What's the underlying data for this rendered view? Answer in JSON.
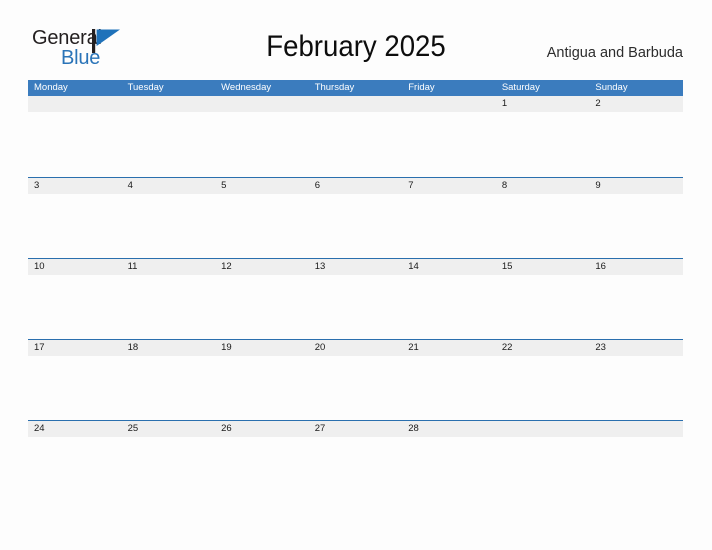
{
  "brand": {
    "name_part_1": "General",
    "name_part_2": "Blue",
    "mark": "flag-triangle-icon",
    "color_dark": "#231f20",
    "color_blue": "#2a74b8"
  },
  "header": {
    "title": "February 2025",
    "locale": "Antigua and Barbuda"
  },
  "colors": {
    "header_blue": "#3b7cbe",
    "rule_blue": "#2a6fae",
    "date_band_gray": "#efefef",
    "page_background": "#fdfdfd"
  },
  "calendar": {
    "month": "February",
    "year": "2025",
    "weekday_headers": [
      "Monday",
      "Tuesday",
      "Wednesday",
      "Thursday",
      "Friday",
      "Saturday",
      "Sunday"
    ],
    "weeks": [
      {
        "days": [
          "",
          "",
          "",
          "",
          "",
          "1",
          "2"
        ]
      },
      {
        "days": [
          "3",
          "4",
          "5",
          "6",
          "7",
          "8",
          "9"
        ]
      },
      {
        "days": [
          "10",
          "11",
          "12",
          "13",
          "14",
          "15",
          "16"
        ]
      },
      {
        "days": [
          "17",
          "18",
          "19",
          "20",
          "21",
          "22",
          "23"
        ]
      },
      {
        "days": [
          "24",
          "25",
          "26",
          "27",
          "28",
          "",
          ""
        ]
      }
    ]
  }
}
